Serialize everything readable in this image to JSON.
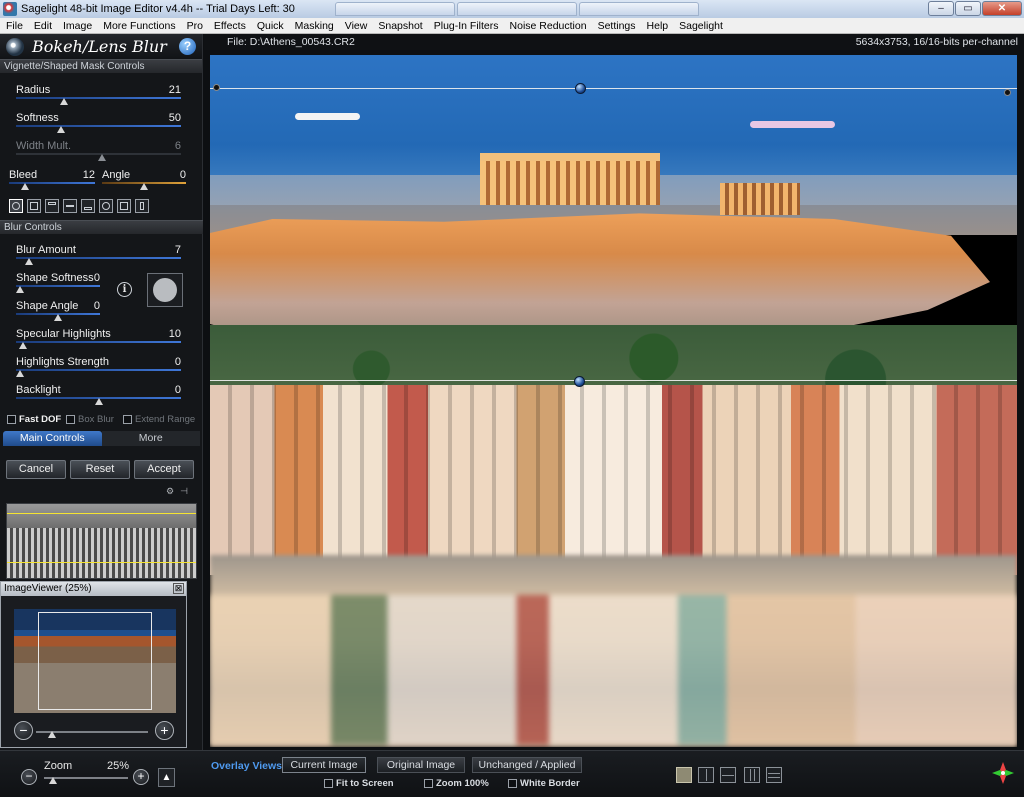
{
  "window": {
    "title": "Sagelight 48-bit Image Editor v4.4h -- Trial Days Left: 30",
    "min_label": "‒",
    "max_label": "▭",
    "close_label": "✕"
  },
  "menu": [
    "File",
    "Edit",
    "Image",
    "More Functions",
    "Pro",
    "Effects",
    "Quick",
    "Masking",
    "View",
    "Snapshot",
    "Plug-In Filters",
    "Noise Reduction",
    "Settings",
    "Help",
    "Sagelight"
  ],
  "plugin": {
    "title": "Bokeh/Lens Blur",
    "help_label": "?"
  },
  "vignette": {
    "header": "Vignette/Shaped Mask Controls",
    "radius": {
      "label": "Radius",
      "value": "21",
      "level": 0.28
    },
    "softness": {
      "label": "Softness",
      "value": "50",
      "level": 0.26
    },
    "width_mult": {
      "label": "Width Mult.",
      "value": "6",
      "level": 0.52
    },
    "bleed": {
      "label": "Bleed",
      "value": "12",
      "level": 0.15
    },
    "angle": {
      "label": "Angle",
      "value": "0",
      "level": 0.5
    }
  },
  "blur": {
    "header": "Blur Controls",
    "blur_amount": {
      "label": "Blur Amount",
      "value": "7",
      "level": 0.06
    },
    "shape_softness": {
      "label": "Shape Softness",
      "value": "0",
      "level": 0.0
    },
    "shape_angle": {
      "label": "Shape Angle",
      "value": "0",
      "level": 0.5
    },
    "specular_highlights": {
      "label": "Specular Highlights",
      "value": "10",
      "level": 0.02
    },
    "highlights_strength": {
      "label": "Highlights Strength",
      "value": "0",
      "level": 0.0
    },
    "backlight": {
      "label": "Backlight",
      "value": "0",
      "level": 0.5
    },
    "info_label": "i"
  },
  "checks": {
    "fast_dof": "Fast DOF",
    "box_blur": "Box Blur",
    "extend_range": "Extend Range"
  },
  "tabs": {
    "main": "Main Controls",
    "more": "More"
  },
  "actions": {
    "cancel": "Cancel",
    "reset": "Reset",
    "accept": "Accept"
  },
  "image_viewer": {
    "title": "ImageViewer (25%)",
    "close_label": "⊠",
    "minus": "−",
    "plus": "+"
  },
  "canvas": {
    "file": "File: D:\\Athens_00543.CR2",
    "dims": "5634x3753, 16/16-bits per-channel"
  },
  "bottom": {
    "zoom_label": "Zoom",
    "zoom_value": "25%",
    "zoom_minus": "−",
    "zoom_plus": "+",
    "up_label": "▲",
    "overlay_label": "Overlay Views",
    "current_image": "Current Image",
    "original_image": "Original Image",
    "unchanged_applied": "Unchanged / Applied",
    "fit_to_screen": "Fit to Screen",
    "zoom_100": "Zoom 100%",
    "white_border": "White Border"
  },
  "colors": {
    "accent_blue": "#3f78c9",
    "overlay_label": "#4f9af0",
    "orange_track": "#e0a23a"
  }
}
